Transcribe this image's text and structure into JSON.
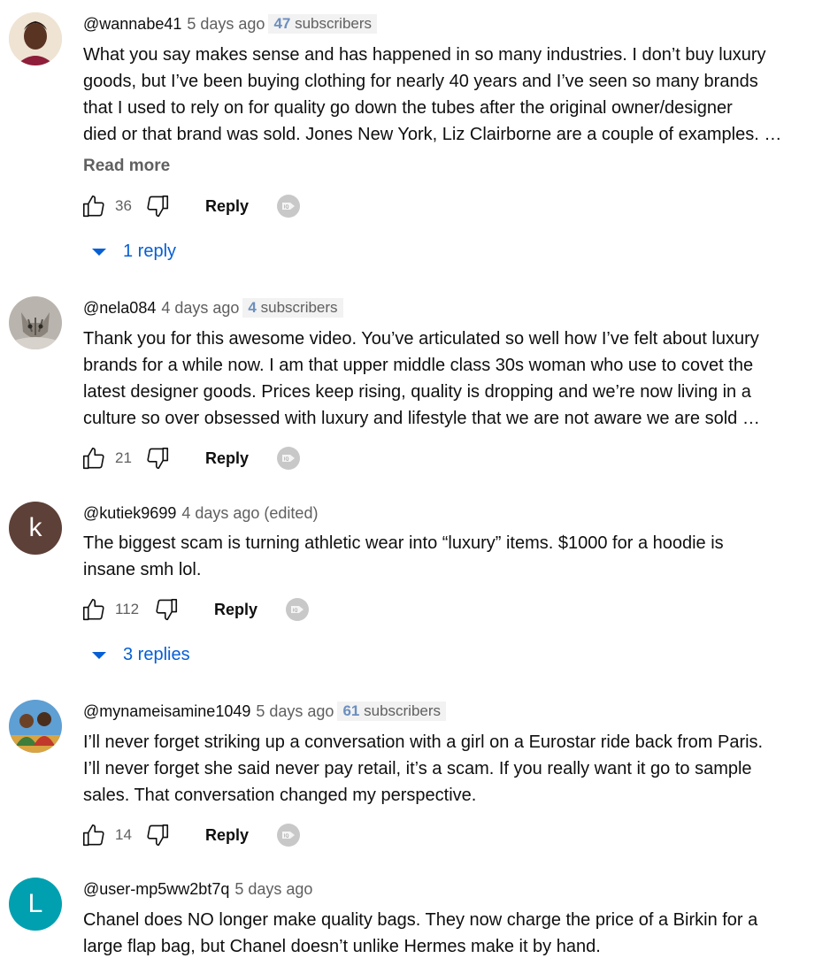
{
  "comments": [
    {
      "author": "@wannabe41",
      "time": "5 days ago",
      "subscribers_count": "47",
      "subscribers_label": "subscribers",
      "text": "What you say makes sense and has happened in so many industries. I don’t buy luxury\ngoods, but I’ve been buying clothing for nearly 40 years and I’ve seen so many brands\nthat I used to rely on for quality go down the tubes after the original owner/designer\ndied or that brand was sold. Jones New York, Liz Clairborne are a couple of examples. …",
      "read_more": "Read more",
      "likes": "36",
      "reply_label": "Reply",
      "replies": "1 reply"
    },
    {
      "author": "@nela084",
      "time": "4 days ago",
      "subscribers_count": "4",
      "subscribers_label": "subscribers",
      "text": "Thank you for this awesome video. You’ve articulated so well how I’ve felt about luxury\nbrands for a while now. I am that upper middle class 30s woman who use to covet the\nlatest designer goods. Prices keep rising, quality is dropping and we’re now living in a\nculture so over obsessed with luxury and lifestyle that we are not aware we are sold …",
      "likes": "21",
      "reply_label": "Reply"
    },
    {
      "author": "@kutiek9699",
      "time": "4 days ago (edited)",
      "avatar_letter": "k",
      "avatar_color": "#5d4037",
      "text": "The biggest scam is turning athletic wear into “luxury” items. $1000 for a hoodie is\ninsane smh lol.",
      "likes": "112",
      "reply_label": "Reply",
      "replies": "3 replies"
    },
    {
      "author": "@mynameisamine1049",
      "time": "5 days ago",
      "subscribers_count": "61",
      "subscribers_label": "subscribers",
      "text": "I’ll never forget striking up a conversation with a girl on a Eurostar ride back from Paris.\nI’ll never forget she said never pay retail, it’s a scam. If you really want it go to sample\nsales. That conversation changed my perspective.",
      "likes": "14",
      "reply_label": "Reply"
    },
    {
      "author": "@user-mp5ww2bt7q",
      "time": "5 days ago",
      "avatar_letter": "L",
      "avatar_color": "#00a0b0",
      "text": "Chanel does NO longer make quality bags. They now charge the price of a Birkin for a\nlarge flap bag, but Chanel doesn’t unlike Hermes make it by hand."
    }
  ]
}
